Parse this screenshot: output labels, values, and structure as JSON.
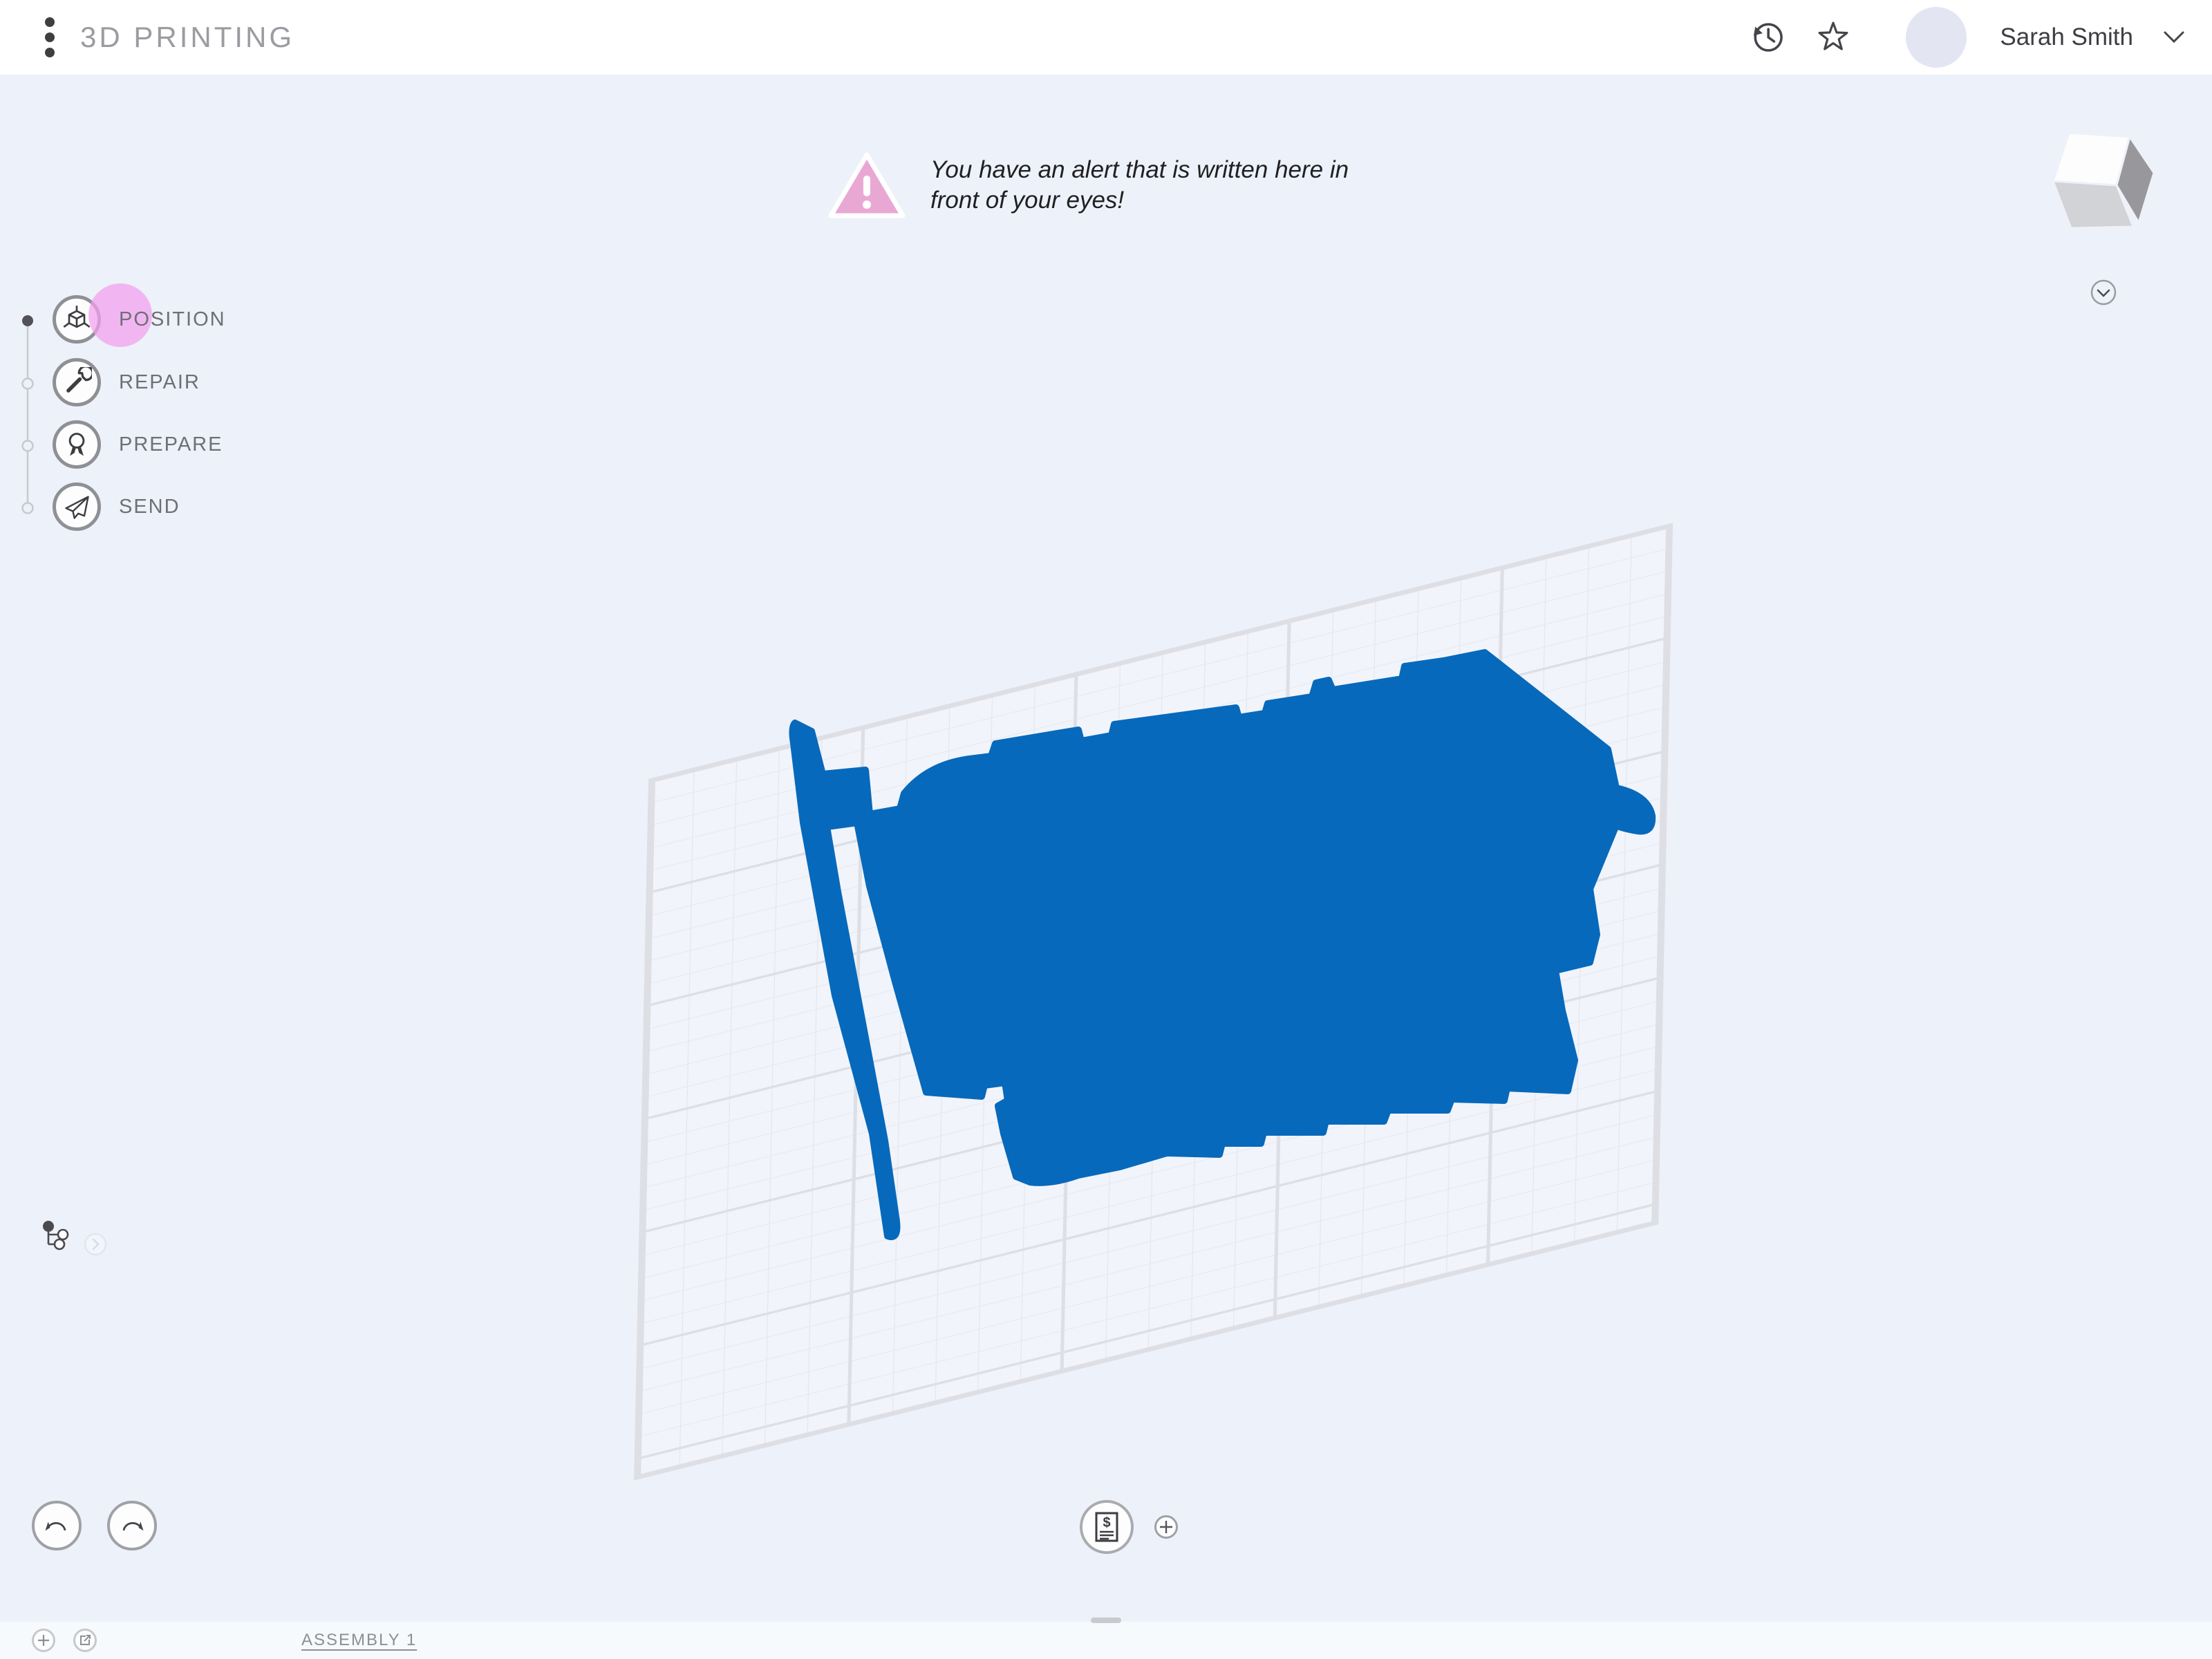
{
  "header": {
    "title": "3D PRINTING",
    "user": {
      "name": "Sarah Smith"
    }
  },
  "alert": {
    "message": "You have an alert that is written here in front of your eyes!"
  },
  "steps": [
    {
      "label": "POSITION",
      "icon": "cube-axes-icon",
      "state": "active"
    },
    {
      "label": "REPAIR",
      "icon": "wrench-icon",
      "state": "pending"
    },
    {
      "label": "PREPARE",
      "icon": "medal-icon",
      "state": "pending"
    },
    {
      "label": "SEND",
      "icon": "paper-plane-icon",
      "state": "pending"
    }
  ],
  "canvas": {
    "model_name": "engine-silhouette",
    "build_plate": "grid"
  },
  "footer": {
    "assembly_tab": "ASSEMBLY 1"
  },
  "icons": {
    "menu": "kebab-menu-icon",
    "history": "history-clock-icon",
    "favorite": "star-icon",
    "user_dropdown": "chevron-down-icon",
    "warning": "warning-triangle-icon",
    "view_cube": "view-cube-icon",
    "view_expand": "chevron-down-circle-icon",
    "scene_tree": "tree-icon",
    "tree_expand": "chevron-right-circle-icon",
    "undo": "undo-arrow-icon",
    "redo": "redo-arrow-icon",
    "cost": "invoice-dollar-icon",
    "zoom_add": "plus-icon",
    "add_item": "plus-icon",
    "export": "open-in-new-icon"
  },
  "colors": {
    "model_blue": "#0769bb",
    "alert_pink": "#e9a8d4",
    "highlight_pink": "#f3a0ee",
    "background": "#edf1f9",
    "header_bg": "#ffffff",
    "bottombar_bg": "#f7fafd",
    "grid_minor": "#e5e6ec",
    "grid_major": "#dedfe5",
    "cube_top": "#fdfdfe",
    "cube_left": "#d2d3d6",
    "cube_right": "#98989c"
  }
}
